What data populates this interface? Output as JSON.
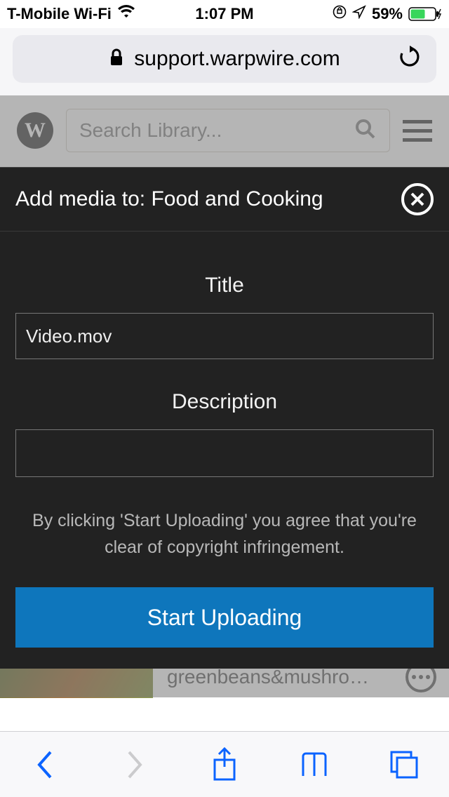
{
  "status": {
    "carrier": "T-Mobile Wi-Fi",
    "time": "1:07 PM",
    "battery_pct": "59%"
  },
  "browser": {
    "domain": "support.warpwire.com"
  },
  "wp": {
    "search_placeholder": "Search Library...",
    "list_item_title": "greenbeans&mushro…"
  },
  "modal": {
    "heading": "Add media to: Food and Cooking",
    "title_label": "Title",
    "title_value": "Video.mov",
    "desc_label": "Description",
    "desc_value": "",
    "disclaimer": "By clicking 'Start Uploading' you agree that you're clear of copyright infringement.",
    "submit": "Start Uploading"
  }
}
